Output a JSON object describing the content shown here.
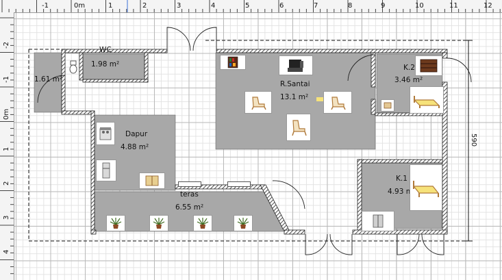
{
  "ruler": {
    "top_labels": [
      "-1",
      "0m",
      "1",
      "2",
      "3",
      "4",
      "5",
      "6",
      "7",
      "8",
      "9",
      "10",
      "11",
      "12"
    ],
    "left_labels": [
      "-2",
      "-1",
      "0m",
      "1",
      "2",
      "3",
      "4"
    ]
  },
  "rooms": {
    "wc": {
      "name": "WC",
      "area": "1.98 m²"
    },
    "small_left": {
      "area": "1.61 m²"
    },
    "santai": {
      "name": "R.Santai",
      "area": "13.1 m²"
    },
    "k2": {
      "name": "K.2",
      "area": "3.46 m²"
    },
    "dapur": {
      "name": "Dapur",
      "area": "4.88 m²"
    },
    "teras": {
      "name": "teras",
      "area": "6.55 m²"
    },
    "k1": {
      "name": "K.1",
      "area": "4.93 m²"
    }
  },
  "dimension": {
    "right_label": "590"
  },
  "colors": {
    "room_fill": "#a8a8a8",
    "wall": "#222222",
    "grid_major": "#b9b9b9",
    "grid_minor": "#e3e3e3"
  },
  "icons": {
    "furniture": [
      "bookshelf-icon",
      "tv-icon",
      "armchair-icon",
      "bed-icon",
      "dresser-icon",
      "nightstand-icon",
      "stove-icon",
      "fridge-icon",
      "cabinet-icon",
      "potted-plant-icon",
      "wardrobe-icon",
      "toilet-icon",
      "door-icon",
      "window-icon"
    ]
  }
}
